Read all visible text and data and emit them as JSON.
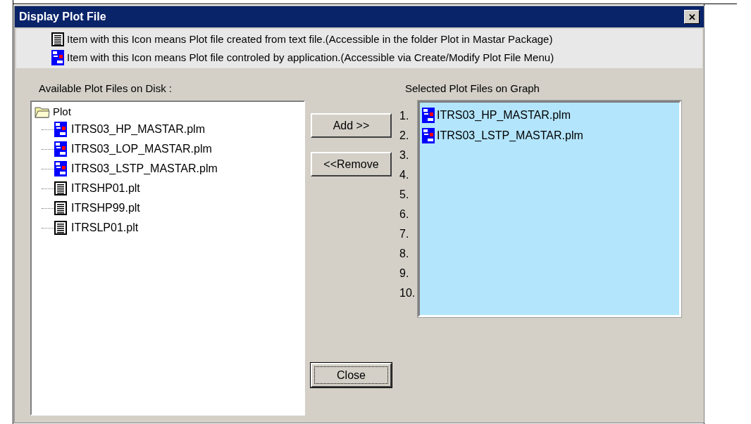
{
  "window": {
    "title": "Display Plot File",
    "close_glyph": "✕"
  },
  "legend": [
    {
      "kind": "plt",
      "text": "Item with this Icon means Plot file created from text file.(Accessible in the folder Plot in Mastar Package)"
    },
    {
      "kind": "plm",
      "text": "Item with this Icon means Plot file controled by application.(Accessible via Create/Modify Plot File Menu)"
    }
  ],
  "available": {
    "label": "Available Plot Files on Disk :",
    "root": {
      "label": "Plot",
      "expanded": true,
      "children": [
        {
          "kind": "plm",
          "label": "ITRS03_HP_MASTAR.plm"
        },
        {
          "kind": "plm",
          "label": "ITRS03_LOP_MASTAR.plm"
        },
        {
          "kind": "plm",
          "label": "ITRS03_LSTP_MASTAR.plm"
        },
        {
          "kind": "plt",
          "label": "ITRSHP01.plt"
        },
        {
          "kind": "plt",
          "label": "ITRSHP99.plt"
        },
        {
          "kind": "plt",
          "label": "ITRSLP01.plt"
        }
      ]
    }
  },
  "buttons": [
    {
      "label": "Add >>",
      "focused": false
    },
    {
      "label": "<<Remove",
      "focused": false
    },
    {
      "label": "Close",
      "focused": true
    }
  ],
  "selected_list": {
    "label": "Selected Plot Files on Graph",
    "numbers": [
      "1.",
      "2.",
      "3.",
      "4.",
      "5.",
      "6.",
      "7.",
      "8.",
      "9.",
      "10."
    ],
    "items": [
      {
        "kind": "plm",
        "label": "ITRS03_HP_MASTAR.plm"
      },
      {
        "kind": "plm",
        "label": "ITRS03_LSTP_MASTAR.plm"
      }
    ]
  }
}
